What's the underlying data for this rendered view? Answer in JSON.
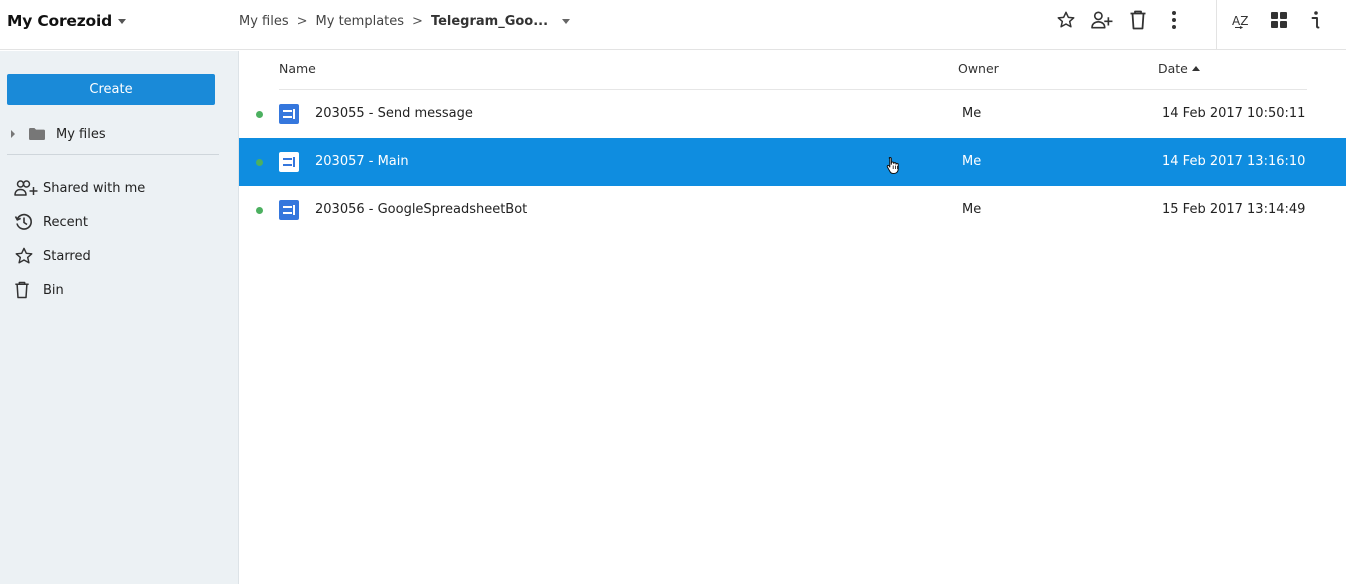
{
  "header": {
    "workspace_title": "My Corezoid",
    "breadcrumbs": [
      "My files",
      "My templates"
    ],
    "breadcrumb_separator": ">",
    "current_folder": "Telegram_Goo...",
    "toolbar_icons": [
      "star-icon",
      "add-user-icon",
      "trash-icon",
      "more-vertical-icon",
      "sort-az-icon",
      "grid-view-icon",
      "info-icon"
    ]
  },
  "sidebar": {
    "create_label": "Create",
    "tree": {
      "label": "My files"
    },
    "nav": [
      {
        "label": "Shared with me",
        "icon": "shared-users-icon"
      },
      {
        "label": "Recent",
        "icon": "recent-clock-icon"
      },
      {
        "label": "Starred",
        "icon": "star-icon"
      },
      {
        "label": "Bin",
        "icon": "trash-icon"
      }
    ]
  },
  "list": {
    "columns": {
      "name": "Name",
      "owner": "Owner",
      "date": "Date"
    },
    "sort": {
      "column": "Date",
      "direction": "ascending"
    },
    "rows": [
      {
        "name": "203055 - Send message",
        "owner": "Me",
        "date": "14 Feb 2017 10:50:11",
        "status": "active",
        "selected": false
      },
      {
        "name": "203057 - Main",
        "owner": "Me",
        "date": "14 Feb 2017 13:16:10",
        "status": "active",
        "selected": true
      },
      {
        "name": "203056 - GoogleSpreadsheetBot",
        "owner": "Me",
        "date": "15 Feb 2017 13:14:49",
        "status": "active",
        "selected": false
      }
    ]
  },
  "colors": {
    "accent": "#1a8ad8",
    "selected_row": "#0f8de0",
    "status_active": "#4cb060",
    "process_icon": "#3577dd",
    "sidebar_bg": "#ecf1f4"
  }
}
